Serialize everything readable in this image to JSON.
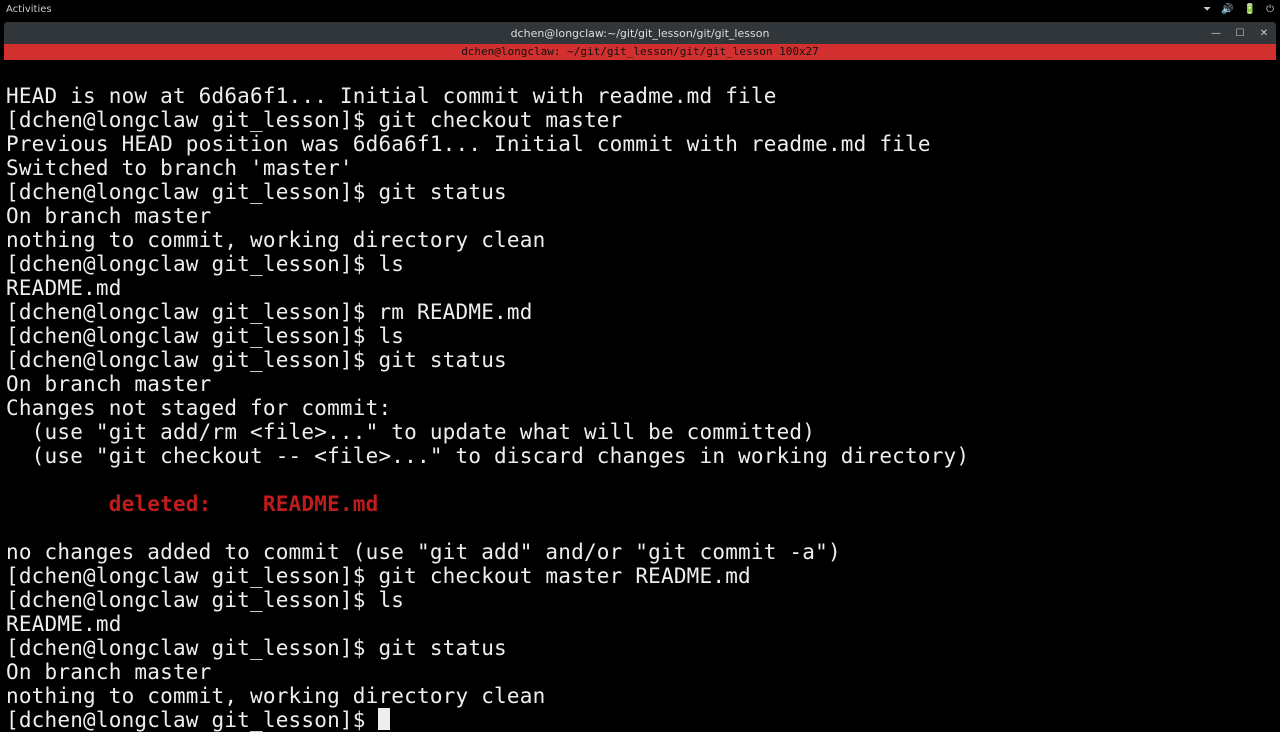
{
  "topbar": {
    "activities": "Activities",
    "icons": {
      "caret": "⏷",
      "volume": "🔊",
      "battery": "🔋",
      "power": "⏻"
    }
  },
  "window": {
    "title": "dchen@longclaw:~/git/git_lesson/git/git_lesson",
    "min": "—",
    "max": "☐",
    "close": "✕"
  },
  "tmux": {
    "status": "dchen@longclaw: ~/git/git_lesson/git/git_lesson 100x27"
  },
  "term": {
    "l01": "HEAD is now at 6d6a6f1... Initial commit with readme.md file",
    "p1": "[dchen@longclaw git_lesson]$ ",
    "c1": "git checkout master",
    "l03": "Previous HEAD position was 6d6a6f1... Initial commit with readme.md file",
    "l04": "Switched to branch 'master'",
    "c2": "git status",
    "l06": "On branch master",
    "l07": "nothing to commit, working directory clean",
    "c3": "ls",
    "l09": "README.md",
    "c4": "rm README.md",
    "c5": "ls",
    "c6": "git status",
    "l13": "On branch master",
    "l14": "Changes not staged for commit:",
    "l15": "  (use \"git add/rm <file>...\" to update what will be committed)",
    "l16": "  (use \"git checkout -- <file>...\" to discard changes in working directory)",
    "l18": "        deleted:    README.md",
    "l20": "no changes added to commit (use \"git add\" and/or \"git commit -a\")",
    "c7": "git checkout master README.md",
    "c8": "ls",
    "l23": "README.md",
    "c9": "git status",
    "l25": "On branch master",
    "l26": "nothing to commit, working directory clean"
  }
}
